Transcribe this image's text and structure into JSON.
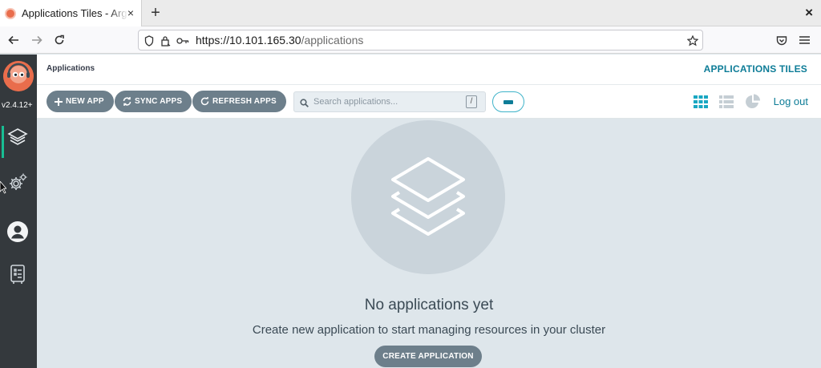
{
  "browser": {
    "tab_title": "Applications Tiles - Argo CD",
    "new_tab_label": "+",
    "tab_close_label": "×",
    "window_close_label": "×",
    "url_host": "https://10.101.165.30",
    "url_path": "/applications"
  },
  "sidebar": {
    "version": "v2.4.12+",
    "items": [
      {
        "icon": "layers-icon",
        "active": true
      },
      {
        "icon": "gear-icon",
        "active": false
      },
      {
        "icon": "user-icon",
        "active": false
      },
      {
        "icon": "docs-icon",
        "active": false
      }
    ]
  },
  "header": {
    "title": "Applications",
    "view_title": "APPLICATIONS TILES"
  },
  "toolbar": {
    "new_app_label": "NEW APP",
    "sync_apps_label": "SYNC APPS",
    "refresh_apps_label": "REFRESH APPS",
    "search_placeholder": "Search applications...",
    "search_shortcut": "/",
    "logout_label": "Log out",
    "active_view": "tiles"
  },
  "empty_state": {
    "title": "No applications yet",
    "subtitle": "Create new application to start managing resources in your cluster",
    "create_button_label": "CREATE APPLICATION"
  },
  "colors": {
    "accent": "#0d7c97",
    "button": "#6d7f8b",
    "sidebar": "#34393d",
    "content_bg": "#dee6eb"
  }
}
